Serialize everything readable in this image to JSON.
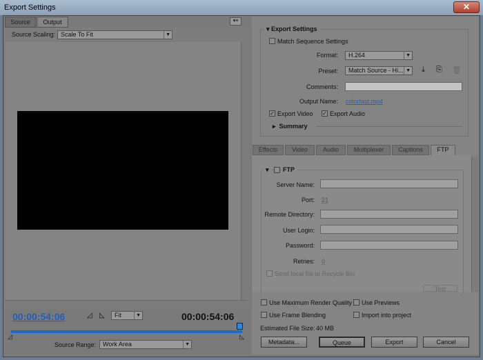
{
  "window": {
    "title": "Export Settings",
    "close_icon": "close-icon"
  },
  "left": {
    "tabs": [
      {
        "label": "Source"
      },
      {
        "label": "Output"
      }
    ],
    "source_scaling_label": "Source Scaling:",
    "source_scaling_value": "Scale To Fit",
    "timecode_current": "00:00:54:06",
    "timecode_duration": "00:00:54:06",
    "zoom_value": "Fit",
    "source_range_label": "Source Range:",
    "source_range_value": "Work Area"
  },
  "export_settings": {
    "heading": "Export Settings",
    "match_sequence": "Match Sequence Settings",
    "match_sequence_checked": false,
    "format_label": "Format:",
    "format_value": "H.264",
    "preset_label": "Preset:",
    "preset_value": "Match Source - Hi...",
    "comments_label": "Comments:",
    "comments_value": "",
    "output_name_label": "Output Name:",
    "output_name_value": "colorfast.mp4",
    "export_video": "Export Video",
    "export_video_checked": true,
    "export_audio": "Export Audio",
    "export_audio_checked": true,
    "summary": "Summary"
  },
  "tabs": [
    {
      "label": "Effects"
    },
    {
      "label": "Video"
    },
    {
      "label": "Audio"
    },
    {
      "label": "Multiplexer"
    },
    {
      "label": "Captions"
    },
    {
      "label": "FTP",
      "active": true
    }
  ],
  "ftp": {
    "heading": "FTP",
    "enabled": false,
    "server_name_label": "Server Name:",
    "port_label": "Port:",
    "port_value": "21",
    "remote_dir_label": "Remote Directory:",
    "user_login_label": "User Login:",
    "password_label": "Password:",
    "retries_label": "Retries:",
    "retries_value": "0",
    "recycle_label": "Send local file to Recycle Bin",
    "test_label": "Test"
  },
  "options": {
    "max_render": "Use Maximum Render Quality",
    "previews": "Use Previews",
    "frame_blending": "Use Frame Blending",
    "import_project": "Import into project",
    "file_size_label": "Estimated File Size:",
    "file_size_value": "40 MB"
  },
  "buttons": {
    "metadata": "Metadata...",
    "queue": "Queue",
    "export": "Export",
    "cancel": "Cancel"
  },
  "colors": {
    "accent": "#1f5fbf",
    "timeline": "#1b6ad0"
  }
}
